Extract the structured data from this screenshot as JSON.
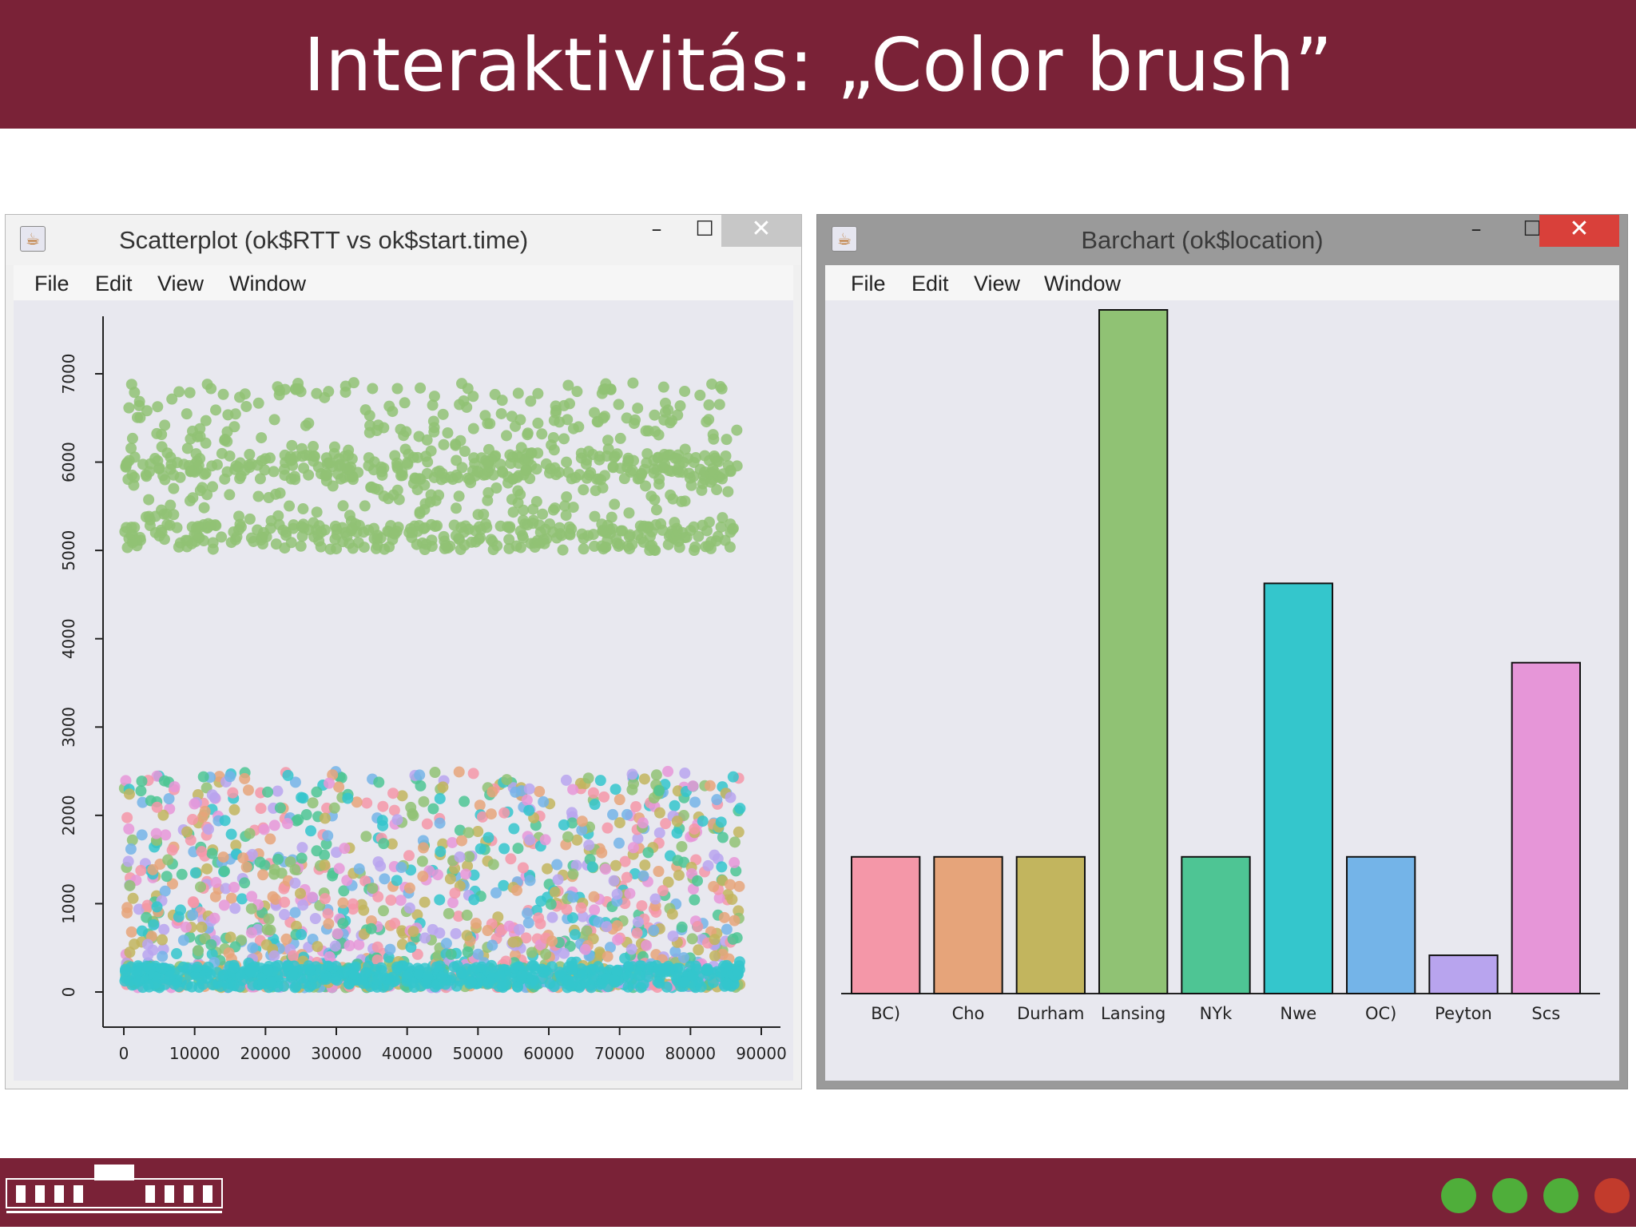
{
  "slide": {
    "title": "Interaktivitás: „Color brush”"
  },
  "windows": {
    "scatter": {
      "title": "Scatterplot (ok$RTT vs ok$start.time)",
      "menu": [
        "File",
        "Edit",
        "View",
        "Window"
      ],
      "controls": {
        "minimize": "–",
        "maximize": "☐",
        "close": "✕"
      }
    },
    "bar": {
      "title": "Barchart (ok$location)",
      "menu": [
        "File",
        "Edit",
        "View",
        "Window"
      ],
      "controls": {
        "minimize": "–",
        "maximize": "☐",
        "close": "✕"
      }
    }
  },
  "colors": {
    "BC)": "#f497a8",
    "Cho": "#e6a47a",
    "Durham": "#c2b55e",
    "Lansing": "#90c274",
    "NYk": "#4ec594",
    "Nwe": "#34c6cc",
    "OC)": "#74b4e8",
    "Peyton": "#b8a4ee",
    "Scs": "#e696d8"
  },
  "chart_data": [
    {
      "type": "scatter",
      "x_ticks": [
        "0",
        "10000",
        "20000",
        "30000",
        "40000",
        "50000",
        "60000",
        "70000",
        "80000",
        "90000"
      ],
      "y_ticks": [
        "0",
        "1000",
        "2000",
        "3000",
        "4000",
        "5000",
        "6000",
        "7000"
      ],
      "xlim": [
        0,
        90000
      ],
      "ylim": [
        0,
        7000
      ],
      "clusters": [
        {
          "category": "Lansing",
          "x_range": [
            0,
            87000
          ],
          "y_range": [
            5100,
            6900
          ],
          "bands": [
            5150,
            5950
          ]
        },
        {
          "category": "mixed",
          "x_range": [
            0,
            87000
          ],
          "y_range": [
            50,
            2500
          ]
        },
        {
          "category": "Nwe",
          "x_range": [
            0,
            87000
          ],
          "y_range": [
            50,
            300
          ]
        }
      ]
    },
    {
      "type": "bar",
      "categories": [
        "BC)",
        "Cho",
        "Durham",
        "Lansing",
        "NYk",
        "Nwe",
        "OC)",
        "Peyton",
        "Scs"
      ],
      "values": [
        1000,
        1000,
        1000,
        5000,
        1000,
        3000,
        1000,
        280,
        2420
      ],
      "ylim": [
        0,
        5000
      ]
    }
  ]
}
